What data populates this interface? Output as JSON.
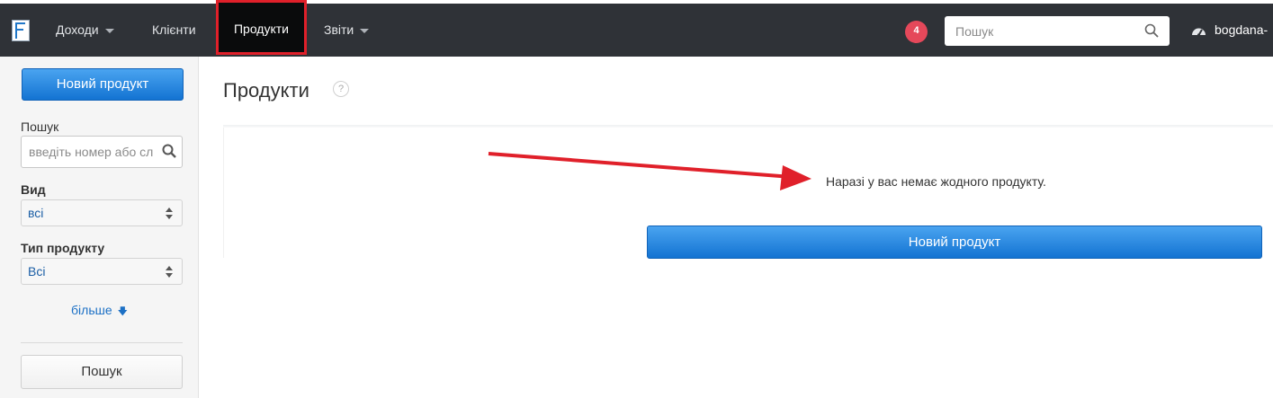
{
  "header": {
    "logo_icon": "f-logo-icon",
    "nav": [
      {
        "label": "Доходи",
        "has_dropdown": true
      },
      {
        "label": "Клієнти",
        "has_dropdown": false
      },
      {
        "label": "Продукти",
        "active": true
      },
      {
        "label": "Звіти",
        "has_dropdown": true
      }
    ],
    "notifications_count": "4",
    "search_placeholder": "Пошук",
    "user_name": "bogdana-"
  },
  "sidebar": {
    "new_product_label": "Новий продукт",
    "search_label": "Пошук",
    "search_placeholder": "введіть номер або сл",
    "type_label": "Вид",
    "type_value": "всі",
    "product_type_label": "Тип продукту",
    "product_type_value": "Всі",
    "more_label": "більше",
    "search_button_label": "Пошук"
  },
  "main": {
    "page_title": "Продукти",
    "help_icon_text": "?",
    "empty_message": "Наразі у вас немає жодного продукту.",
    "new_product_label": "Новий продукт"
  },
  "colors": {
    "topbar": "#2f3237",
    "primary_button": "#1a7fd9",
    "badge": "#e5485a",
    "annotation": "#e0202a"
  }
}
